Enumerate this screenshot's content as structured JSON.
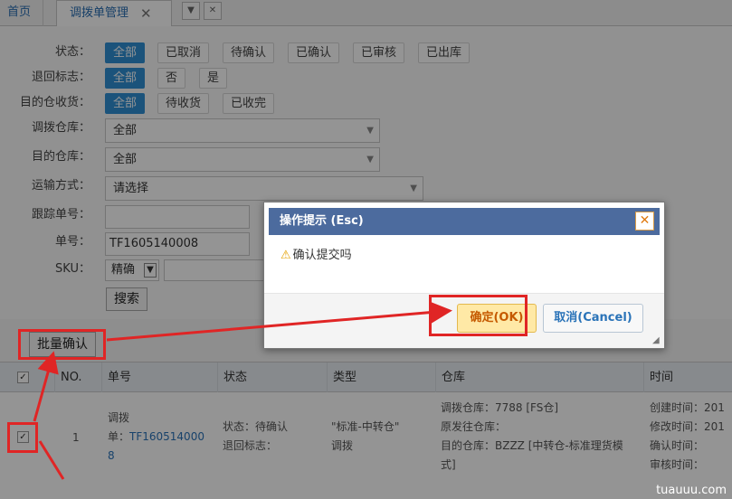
{
  "tabs": {
    "home": "首页",
    "active": "调拨单管理",
    "close": "✕",
    "dropdown": "▼",
    "close_all": "✕"
  },
  "filter": {
    "status": {
      "label": "状态：",
      "options": [
        "全部",
        "已取消",
        "待确认",
        "已确认",
        "已审核",
        "已出库"
      ],
      "selected": "全部"
    },
    "return_flag": {
      "label": "退回标志：",
      "options": [
        "全部",
        "否",
        "是"
      ],
      "selected": "全部"
    },
    "dest_receive": {
      "label": "目的仓收货：",
      "options": [
        "全部",
        "待收货",
        "已收完"
      ],
      "selected": "全部"
    },
    "transfer_warehouse": {
      "label": "调拨仓库：",
      "value": "全部"
    },
    "dest_warehouse": {
      "label": "目的仓库：",
      "value": "全部"
    },
    "shipping": {
      "label": "运输方式：",
      "value": "请选择"
    },
    "tracking": {
      "label": "跟踪单号：",
      "value": ""
    },
    "order_no": {
      "label": "单号：",
      "value": "TF1605140008"
    },
    "sku": {
      "label": "SKU：",
      "mode": "精确",
      "value": ""
    },
    "search_button": "搜索"
  },
  "toolbar": {
    "batch_confirm": "批量确认"
  },
  "table": {
    "headers": [
      "NO.",
      "单号",
      "状态",
      "类型",
      "仓库",
      "时间"
    ],
    "rows": [
      {
        "no": "1",
        "order_prefix": "调拨",
        "order_prefix2": "单：",
        "order_link_a": "TF160514000",
        "order_link_b": "8",
        "status_line1": "状态：待确认",
        "status_line2": "退回标志：",
        "type_line1": "\"标准-中转仓\"",
        "type_line2": "调拨",
        "wh_line1": "调拨仓库：7788 [FS仓]",
        "wh_line2": "原发往仓库：",
        "wh_line3": "目的仓库：BZZZ [中转仓-标准理货模",
        "wh_line4": "式]",
        "time_line1": "创建时间：201",
        "time_line2": "修改时间：201",
        "time_line3": "确认时间：",
        "time_line4": "审核时间："
      }
    ]
  },
  "dialog": {
    "title": "操作提示 (Esc)",
    "message": "确认提交吗",
    "ok": "确定(OK)",
    "cancel": "取消(Cancel)"
  },
  "watermark": "tuauuu.com",
  "colors": {
    "accent": "#2f8fd4",
    "dialog_header": "#4c6b9e",
    "highlight": "#e02525"
  }
}
